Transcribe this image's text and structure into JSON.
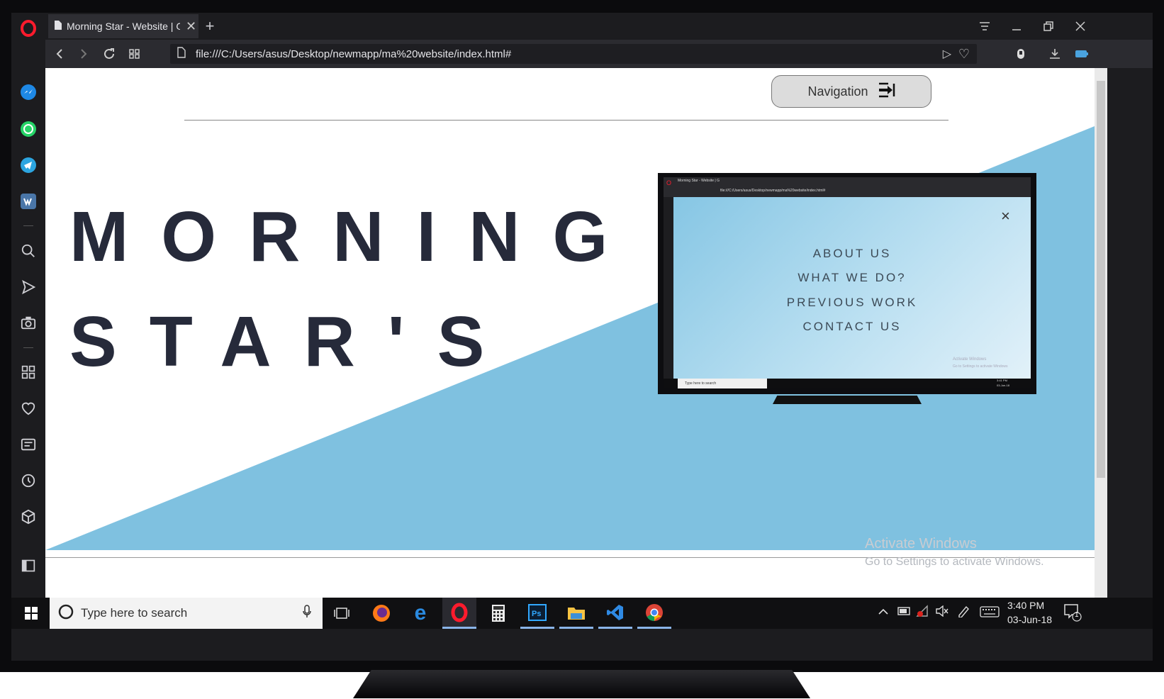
{
  "browser": {
    "tab_title": "Morning Star - Website | G",
    "new_tab_symbol": "+",
    "url": "file:///C:/Users/asus/Desktop/newmapp/ma%20website/index.html#"
  },
  "page": {
    "nav_button_label": "Navigation",
    "title_line1": "MORNING",
    "title_line2": "STAR'S",
    "watermark_title": "Activate Windows",
    "watermark_sub": "Go to Settings to activate Windows."
  },
  "mini_screenshot": {
    "tab_title": "Morning Star - Website | G",
    "url": "file:///C:/Users/asus/Desktop/newmapp/ma%20website/index.html#",
    "close_symbol": "×",
    "menu": [
      "ABOUT US",
      "WHAT WE DO?",
      "PREVIOUS WORK",
      "CONTACT US"
    ],
    "watermark_title": "Activate Windows",
    "watermark_sub": "Go to Settings to activate Windows",
    "search_placeholder": "Type here to search",
    "time": "3:41 PM",
    "date": "03-Jun-18"
  },
  "taskbar": {
    "search_placeholder": "Type here to search",
    "time": "3:40 PM",
    "date": "03-Jun-18",
    "notification_count": "1",
    "apps": [
      "task-view",
      "firefox",
      "edge",
      "opera",
      "calculator",
      "photoshop",
      "file-explorer",
      "vscode",
      "chrome"
    ]
  },
  "colors": {
    "accent_blue": "#7fc1e0",
    "title_text": "#262a3a",
    "opera_red": "#ff1b2d"
  }
}
